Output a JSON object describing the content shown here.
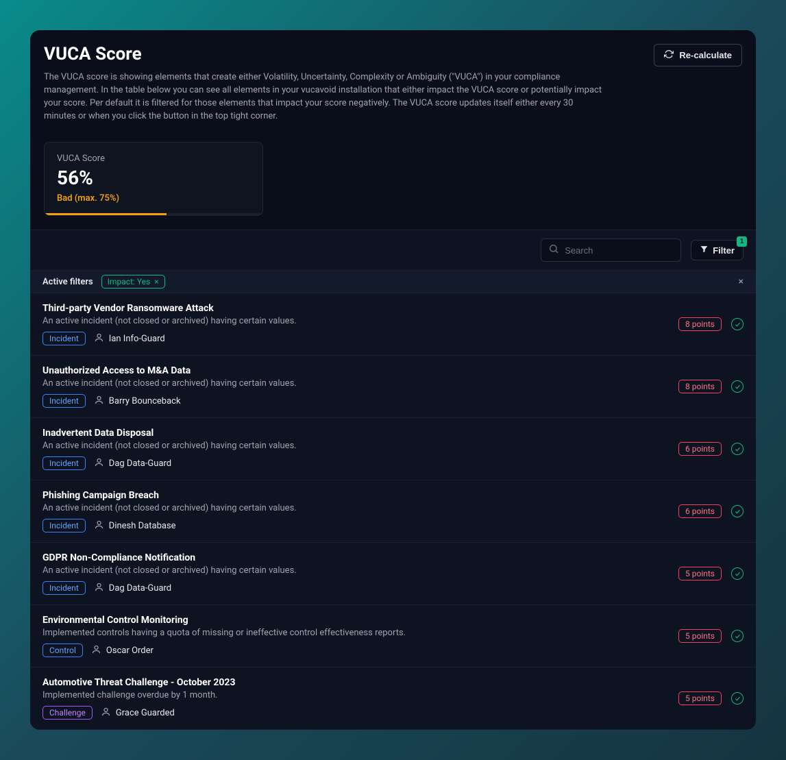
{
  "header": {
    "title": "VUCA Score",
    "description": "The VUCA score is showing elements that create either Volatility, Uncertainty, Complexity or Ambiguity (\"VUCA\") in your compliance management. In the table below you can see all elements in your vucavoid installation that either impact the VUCA score or potentially impact your score. Per default it is filtered for those elements that impact your score negatively. The VUCA score updates itself either every 30 minutes or when you click the button in the top tight corner.",
    "recalculate_label": "Re-calculate"
  },
  "score_card": {
    "label": "VUCA Score",
    "value": "56%",
    "status": "Bad (max. 75%)",
    "progress_pct": 56
  },
  "toolbar": {
    "search_placeholder": "Search",
    "filter_label": "Filter",
    "filter_count": "1"
  },
  "active_filters": {
    "label": "Active filters",
    "chips": [
      {
        "text": "Impact: Yes"
      }
    ]
  },
  "rows": [
    {
      "title": "Third-party Vendor Ransomware Attack",
      "desc": "An active incident (not closed or archived) having certain values.",
      "type": "Incident",
      "person": "Ian Info-Guard",
      "points": "8 points"
    },
    {
      "title": "Unauthorized Access to M&A Data",
      "desc": "An active incident (not closed or archived) having certain values.",
      "type": "Incident",
      "person": "Barry Bounceback",
      "points": "8 points"
    },
    {
      "title": "Inadvertent Data Disposal",
      "desc": "An active incident (not closed or archived) having certain values.",
      "type": "Incident",
      "person": "Dag Data-Guard",
      "points": "6 points"
    },
    {
      "title": "Phishing Campaign Breach",
      "desc": "An active incident (not closed or archived) having certain values.",
      "type": "Incident",
      "person": "Dinesh Database",
      "points": "6 points"
    },
    {
      "title": "GDPR Non-Compliance Notification",
      "desc": "An active incident (not closed or archived) having certain values.",
      "type": "Incident",
      "person": "Dag Data-Guard",
      "points": "5 points"
    },
    {
      "title": "Environmental Control Monitoring",
      "desc": "Implemented controls having a quota of missing or ineffective control effectiveness reports.",
      "type": "Control",
      "person": "Oscar Order",
      "points": "5 points"
    },
    {
      "title": "Automotive Threat Challenge - October 2023",
      "desc": "Implemented challenge overdue by 1 month.",
      "type": "Challenge",
      "person": "Grace Guarded",
      "points": "5 points"
    }
  ]
}
